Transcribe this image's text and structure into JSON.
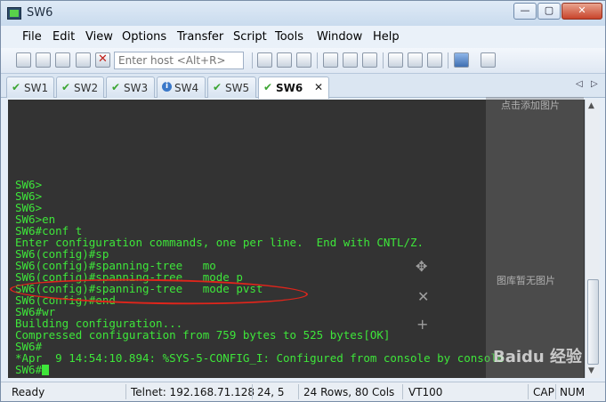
{
  "window": {
    "title": "SW6"
  },
  "title_buttons": {
    "minimize": "—",
    "maximize": "▢",
    "close": "✕"
  },
  "menu": [
    "File",
    "Edit",
    "View",
    "Options",
    "Transfer",
    "Script",
    "Tools",
    "Window",
    "Help"
  ],
  "toolbar": {
    "host_placeholder": "Enter host <Alt+R>"
  },
  "tabs": [
    {
      "label": "SW1",
      "status": "connected"
    },
    {
      "label": "SW2",
      "status": "connected"
    },
    {
      "label": "SW3",
      "status": "connected"
    },
    {
      "label": "SW4",
      "status": "info"
    },
    {
      "label": "SW5",
      "status": "connected"
    },
    {
      "label": "SW6",
      "status": "connected",
      "active": true,
      "close": "✕"
    }
  ],
  "tab_nav": {
    "left": "◁",
    "right": "▷"
  },
  "terminal": {
    "lines": [
      "SW6>",
      "SW6>",
      "SW6>",
      "SW6>en",
      "SW6#conf t",
      "Enter configuration commands, one per line.  End with CNTL/Z.",
      "SW6(config)#sp",
      "SW6(config)#spanning-tree   mo",
      "SW6(config)#spanning-tree   mode p",
      "SW6(config)#spanning-tree   mode pvst",
      "SW6(config)#end",
      "SW6#wr",
      "Building configuration...",
      "Compressed configuration from 759 bytes to 525 bytes[OK]",
      "SW6#",
      "*Apr  9 14:54:10.894: %SYS-5-CONFIG_I: Configured from console by console",
      "SW6#"
    ],
    "colors": {
      "background": "#333333",
      "text": "#3ee63a",
      "annotation": "#e0251b"
    }
  },
  "overlay": {
    "add_image": "点击添加图片",
    "no_image": "图库暂无图片",
    "icons": [
      "move-icon",
      "close-icon",
      "plus-icon"
    ],
    "move": "✥",
    "close": "✕",
    "plus": "+"
  },
  "watermark": "Baidu 经验",
  "status": {
    "ready": "Ready",
    "connection": "Telnet: 192.168.71.128",
    "cursor": "24,   5",
    "size": "24 Rows, 80 Cols",
    "terminal_type": "VT100",
    "caps": "CAP",
    "num": "NUM"
  }
}
